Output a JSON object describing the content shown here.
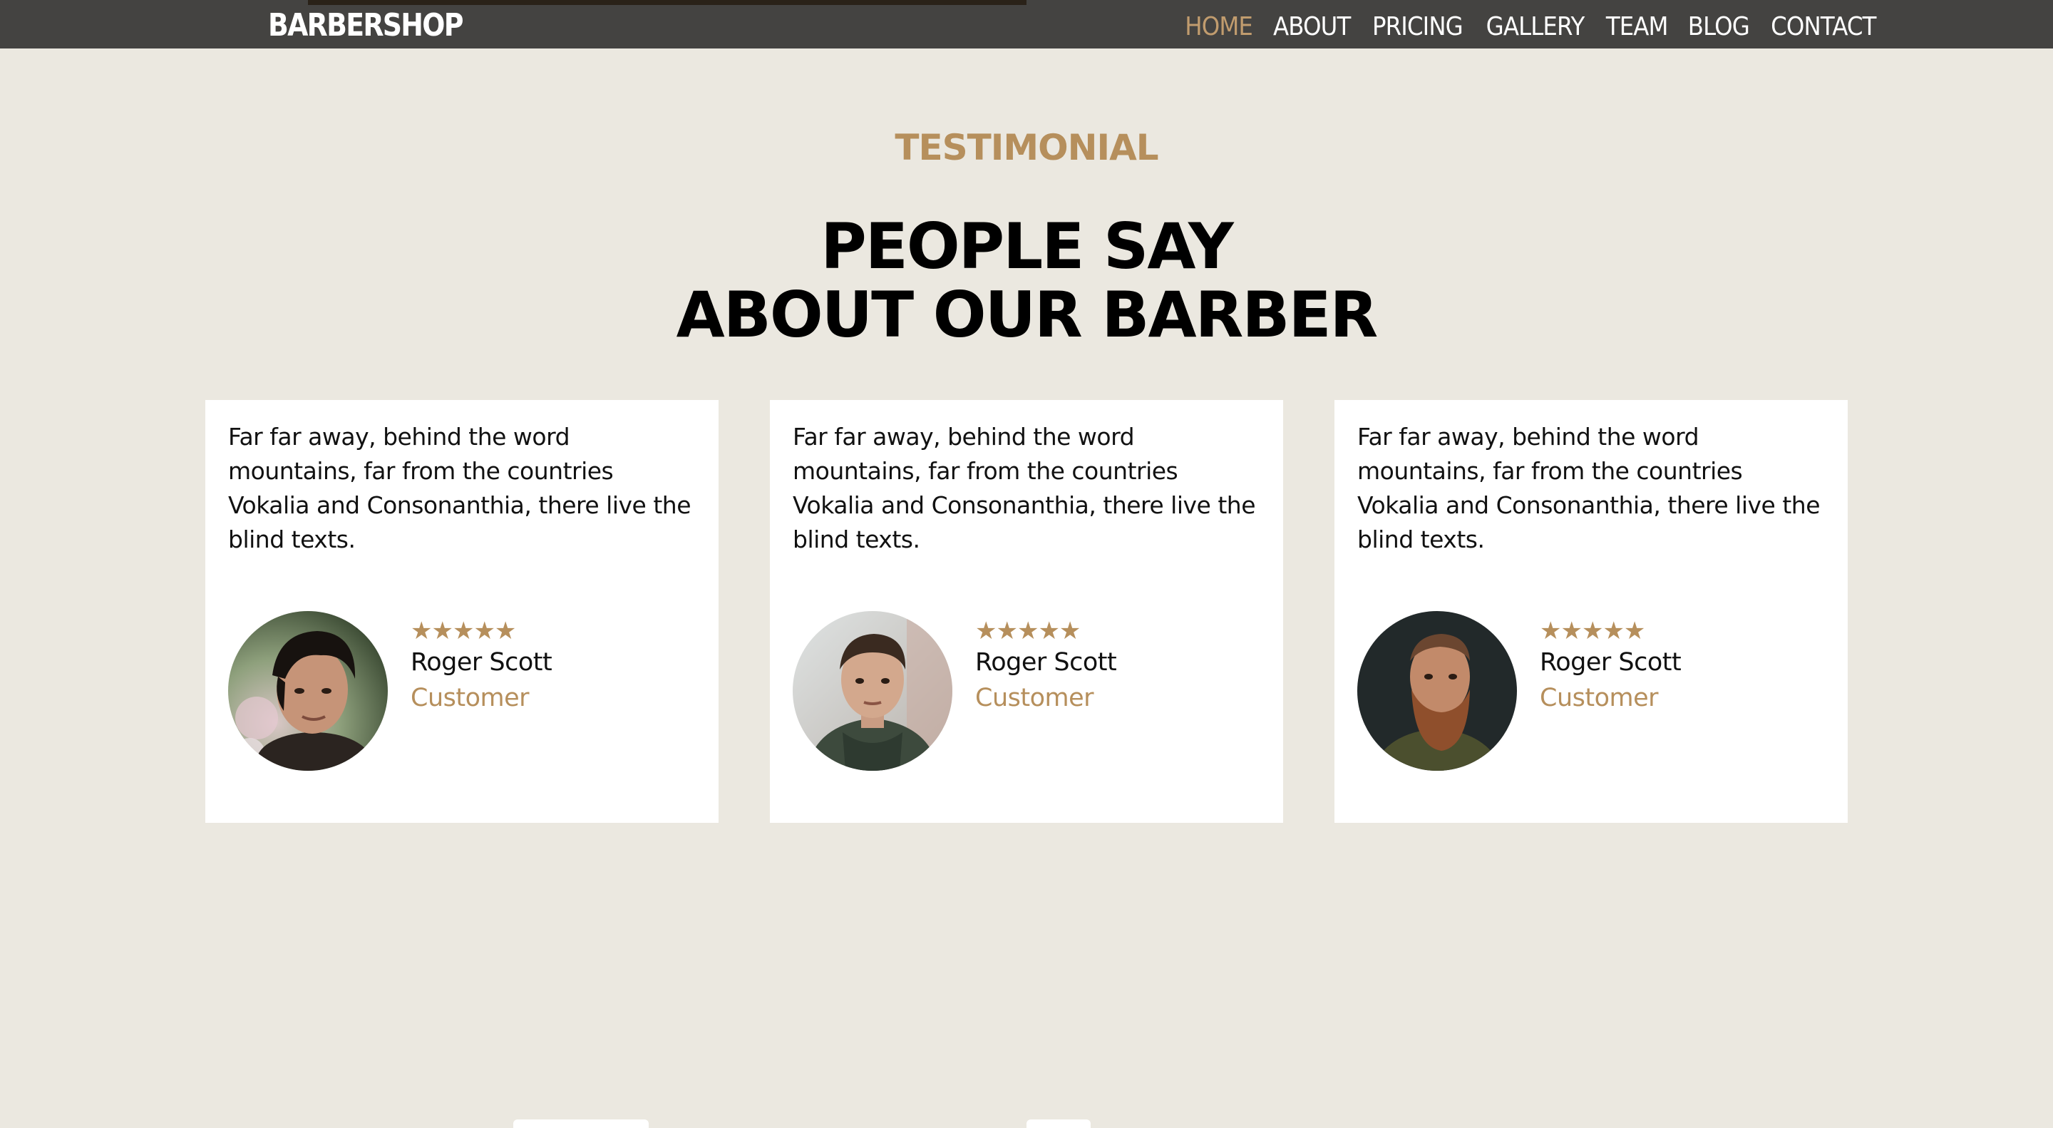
{
  "navbar": {
    "brand": "BARBERSHOP",
    "menu": [
      {
        "label": "HOME",
        "active": true
      },
      {
        "label": "ABOUT",
        "active": false
      },
      {
        "label": "PRICING",
        "active": false
      },
      {
        "label": "GALLERY",
        "active": false
      },
      {
        "label": "TEAM",
        "active": false
      },
      {
        "label": "BLOG",
        "active": false
      },
      {
        "label": "CONTACT",
        "active": false
      }
    ]
  },
  "testimonial": {
    "subheading": "TESTIMONIAL",
    "heading_line1": "PEOPLE SAY",
    "heading_line2": "ABOUT OUR BARBER",
    "cards": [
      {
        "text": "Far far away, behind the word mountains, far from the countries Vokalia and Consonanthia, there live the blind texts.",
        "stars": "★★★★★",
        "rating": 5,
        "name": "Roger Scott",
        "role": "Customer"
      },
      {
        "text": "Far far away, behind the word mountains, far from the countries Vokalia and Consonanthia, there live the blind texts.",
        "stars": "★★★★★",
        "rating": 5,
        "name": "Roger Scott",
        "role": "Customer"
      },
      {
        "text": "Far far away, behind the word mountains, far from the countries Vokalia and Consonanthia, there live the blind texts.",
        "stars": "★★★★★",
        "rating": 5,
        "name": "Roger Scott",
        "role": "Customer"
      }
    ]
  },
  "colors": {
    "accent": "#b68f5c",
    "nav_active": "#c19c6e",
    "navbar_bg": "#444341",
    "page_bg": "#ebe8e0",
    "card_bg": "#ffffff"
  }
}
